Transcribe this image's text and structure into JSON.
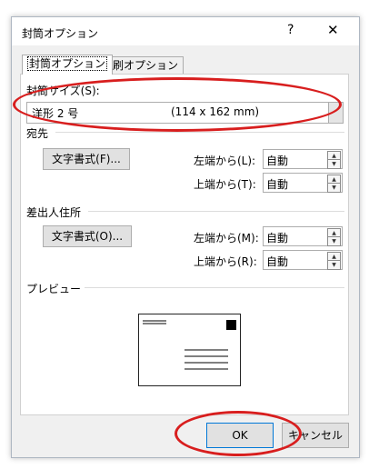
{
  "window": {
    "title": "封筒オプション",
    "help_glyph": "?",
    "close_glyph": "✕"
  },
  "tabs": [
    {
      "label": "封筒オプション",
      "active": true
    },
    {
      "label": "印刷オプション",
      "active": false
    }
  ],
  "envelope_size": {
    "label": "封筒サイズ(S):",
    "selected_name": "洋形 2 号",
    "selected_dimensions": "(114 x 162 mm)"
  },
  "delivery": {
    "heading": "宛先",
    "font_button": "文字書式(F)...",
    "left_label": "左端から(L):",
    "left_value": "自動",
    "top_label": "上端から(T):",
    "top_value": "自動"
  },
  "return_address": {
    "heading": "差出人住所",
    "font_button": "文字書式(O)...",
    "left_label": "左端から(M):",
    "left_value": "自動",
    "top_label": "上端から(R):",
    "top_value": "自動"
  },
  "preview": {
    "heading": "プレビュー"
  },
  "buttons": {
    "ok": "OK",
    "cancel": "キャンセル"
  },
  "colors": {
    "annotation_red": "#d81e1e",
    "ok_focus": "#0078d7"
  }
}
